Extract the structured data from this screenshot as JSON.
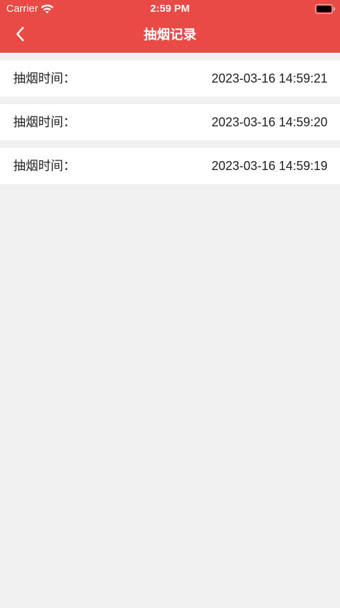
{
  "status_bar": {
    "carrier": "Carrier",
    "time": "2:59 PM",
    "wifi_icon": "wifi-icon",
    "battery_icon": "battery-icon"
  },
  "nav": {
    "title": "抽烟记录",
    "back_icon": "chevron-left-icon",
    "background_color": "#e94a45"
  },
  "records": [
    {
      "label": "抽烟时间：",
      "value": "2023-03-16 14:59:21"
    },
    {
      "label": "抽烟时间：",
      "value": "2023-03-16 14:59:20"
    },
    {
      "label": "抽烟时间：",
      "value": "2023-03-16 14:59:19"
    }
  ]
}
